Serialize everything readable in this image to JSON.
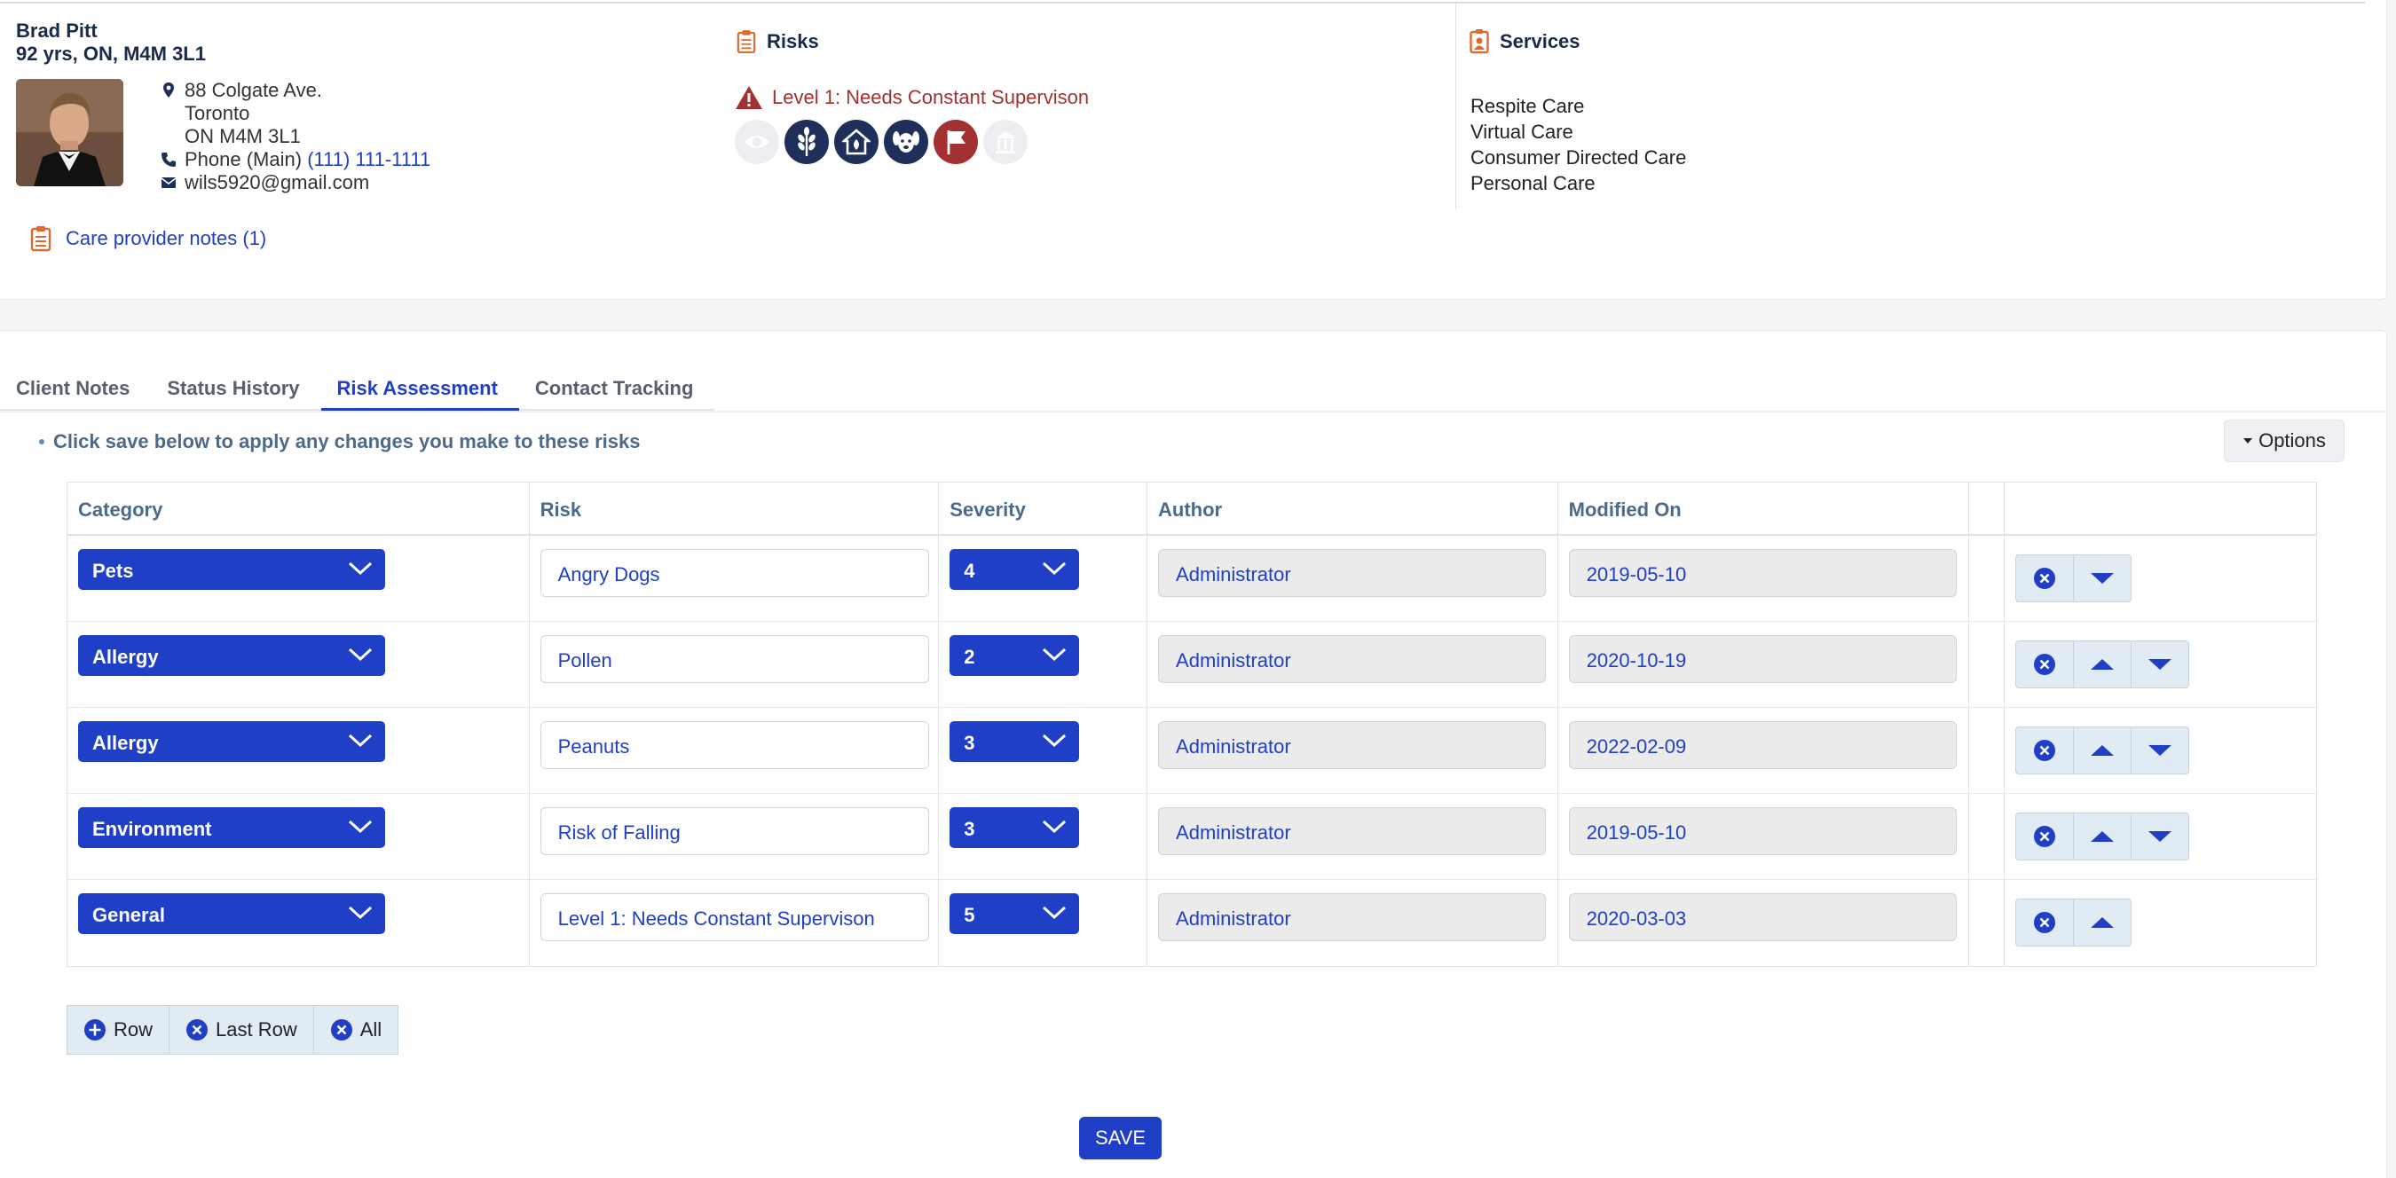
{
  "client": {
    "name": "Brad Pitt",
    "meta": "92 yrs, ON, M4M 3L1",
    "address_line1": "88 Colgate Ave.",
    "address_line2": "Toronto",
    "address_line3": "ON M4M 3L1",
    "phone_label": "Phone (Main)",
    "phone_value": "(111) 111-1111",
    "email": "wils5920@gmail.com",
    "notes_link": "Care provider notes (1)"
  },
  "risks_panel": {
    "title": "Risks",
    "level_text": "Level 1: Needs Constant Supervison",
    "icons": [
      "eye-icon",
      "wheat-allergy-icon",
      "home-environment-icon",
      "dog-icon",
      "flag-icon",
      "building-icon"
    ]
  },
  "services_panel": {
    "title": "Services",
    "items": [
      "Respite Care",
      "Virtual Care",
      "Consumer Directed Care",
      "Personal Care"
    ]
  },
  "tabs": [
    "Client Notes",
    "Status History",
    "Risk Assessment",
    "Contact Tracking"
  ],
  "active_tab": "Risk Assessment",
  "hint": "Click save below to apply any changes you make to these risks",
  "options_label": "Options",
  "table": {
    "headers": [
      "Category",
      "Risk",
      "Severity",
      "Author",
      "Modified On",
      "",
      ""
    ],
    "rows": [
      {
        "category": "Pets",
        "risk": "Angry Dogs",
        "severity": "4",
        "author": "Administrator",
        "modified": "2019-05-10"
      },
      {
        "category": "Allergy",
        "risk": "Pollen",
        "severity": "2",
        "author": "Administrator",
        "modified": "2020-10-19"
      },
      {
        "category": "Allergy",
        "risk": "Peanuts",
        "severity": "3",
        "author": "Administrator",
        "modified": "2022-02-09"
      },
      {
        "category": "Environment",
        "risk": "Risk of Falling",
        "severity": "3",
        "author": "Administrator",
        "modified": "2019-05-10"
      },
      {
        "category": "General",
        "risk": "Level 1: Needs Constant Supervison",
        "severity": "5",
        "author": "Administrator",
        "modified": "2020-03-03"
      }
    ]
  },
  "bulk_actions": {
    "add_row": "Row",
    "remove_last": "Last Row",
    "remove_all": "All"
  },
  "save_label": "SAVE",
  "colors": {
    "primary": "#1f3fc6",
    "accent_orange": "#e06a2c",
    "risk_red": "#a33131",
    "navy": "#1e2f5a"
  }
}
